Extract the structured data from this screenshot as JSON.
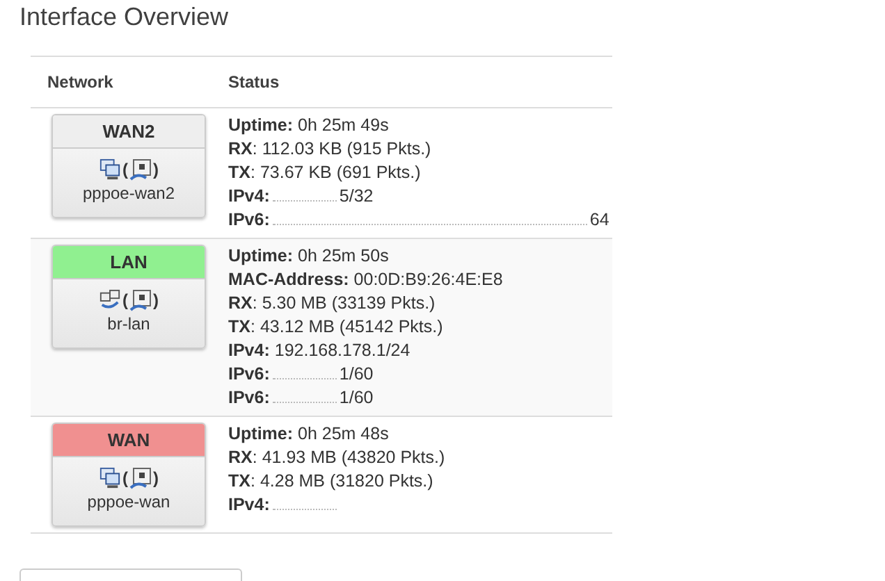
{
  "title": "Interface Overview",
  "table": {
    "columns": [
      "Network",
      "Status"
    ],
    "rows": [
      {
        "network": {
          "name": "WAN2",
          "color": "#eeeeee",
          "kind": "pppoe",
          "bracket_open": "(",
          "bracket_close": ")",
          "device": "pppoe-wan2"
        },
        "lines": [
          {
            "label": "**Uptime:**",
            "value": "0h 25m 49s",
            "kind": "plain"
          },
          {
            "label": "**RX**:",
            "value": "112.03 KB (915 Pkts.)",
            "kind": "plain"
          },
          {
            "label": "**TX**:",
            "value": "73.67 KB (691 Pkts.)",
            "kind": "plain"
          },
          {
            "label": "**IPv4:**",
            "value": "5/32",
            "kind": "masked"
          },
          {
            "label": "**IPv6:**",
            "value": "64",
            "kind": "masked"
          }
        ]
      },
      {
        "network": {
          "name": "LAN",
          "color": "#90f090",
          "kind": "bridge",
          "bracket_open": "(",
          "bracket_close": ")",
          "device": "br-lan"
        },
        "lines": [
          {
            "label": "**Uptime:**",
            "value": "0h 25m 50s",
            "kind": "plain"
          },
          {
            "label": "**MAC-Address:**",
            "value": "00:0D:B9:26:4E:E8",
            "kind": "plain"
          },
          {
            "label": "**RX**:",
            "value": "5.30 MB (33139 Pkts.)",
            "kind": "plain"
          },
          {
            "label": "**TX**:",
            "value": "43.12 MB (45142 Pkts.)",
            "kind": "plain"
          },
          {
            "label": "**IPv4:**",
            "value": "192.168.178.1/24",
            "kind": "plain"
          },
          {
            "label": "**IPv6:**",
            "value": "1/60",
            "kind": "masked"
          },
          {
            "label": "**IPv6:**",
            "value": "1/60",
            "kind": "masked"
          }
        ]
      },
      {
        "network": {
          "name": "WAN",
          "color": "#f09090",
          "kind": "pppoe",
          "bracket_open": "(",
          "bracket_close": ")",
          "device": "pppoe-wan"
        },
        "lines": [
          {
            "label": "**Uptime:**",
            "value": "0h 25m 48s",
            "kind": "plain"
          },
          {
            "label": "**RX**:",
            "value": "41.93 MB (43820 Pkts.)",
            "kind": "plain"
          },
          {
            "label": "**TX**:",
            "value": "4.28 MB (31820 Pkts.)",
            "kind": "plain"
          },
          {
            "label": "**IPv4:**",
            "kind": "masked"
          }
        ]
      }
    ]
  }
}
